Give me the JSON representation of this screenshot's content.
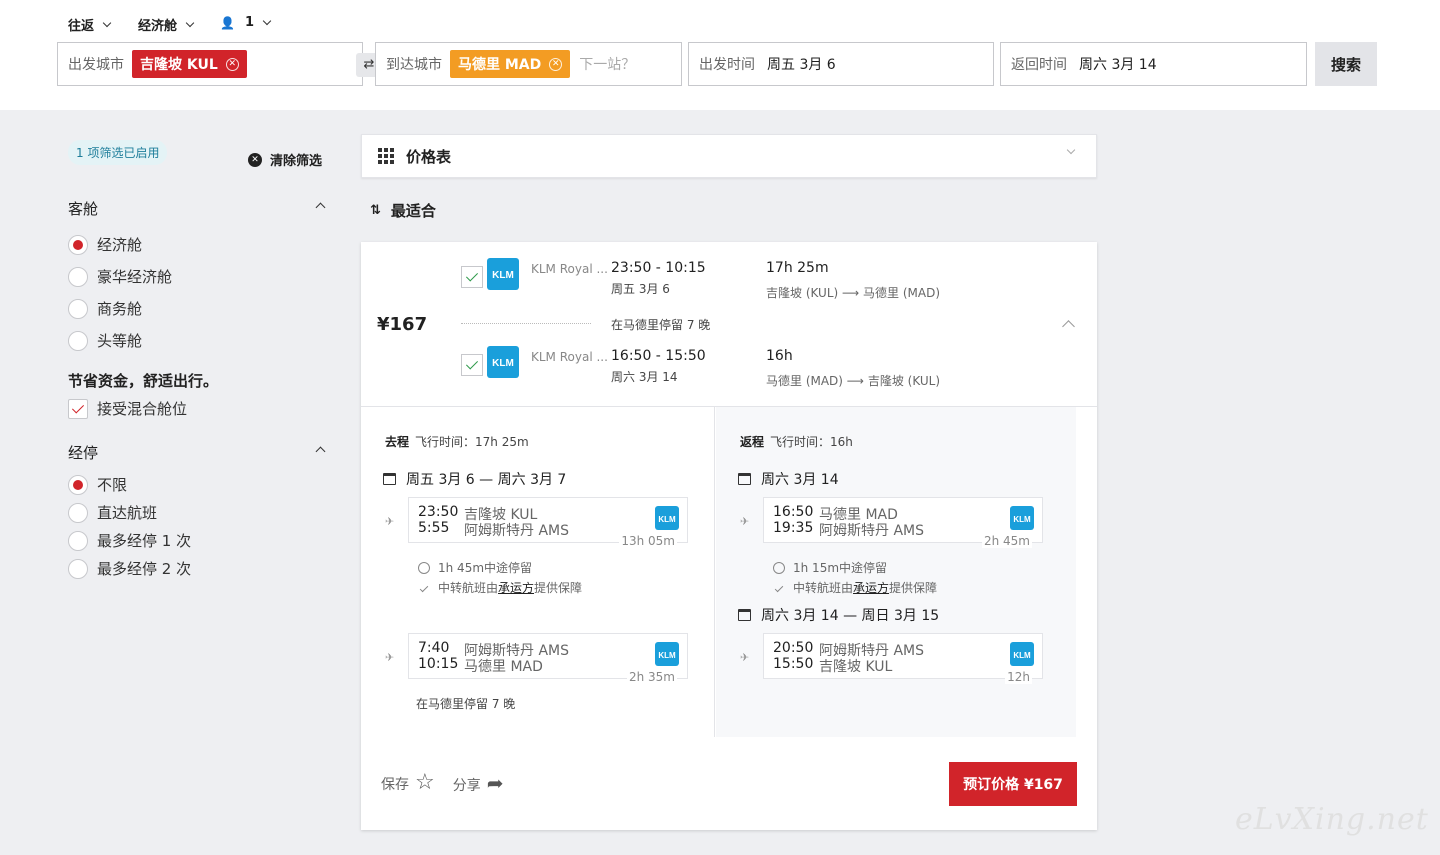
{
  "search": {
    "trip_type": "往返",
    "cabin_class": "经济舱",
    "passengers": "1",
    "from_label": "出发城市",
    "from_value": "吉隆坡 KUL",
    "to_label": "到达城市",
    "to_value": "马德里 MAD",
    "next_stop_placeholder": "下一站？",
    "depart_label": "出发时间",
    "depart_value": "周五 3月 6",
    "return_label": "返回时间",
    "return_value": "周六 3月 14",
    "search_label": "搜索"
  },
  "filters": {
    "active_badge": "1 项筛选已启用",
    "clear_label": "清除筛选",
    "cabin_title": "客舱",
    "cabin_options": [
      "经济舱",
      "豪华经济舱",
      "商务舱",
      "头等舱"
    ],
    "cabin_selected": 0,
    "mixed_title": "节省资金，舒适出行。",
    "mixed_label": "接受混合舱位",
    "stops_title": "经停",
    "stops_options": [
      "不限",
      "直达航班",
      "最多经停 1 次",
      "最多经停 2 次"
    ],
    "stops_selected": 0
  },
  "price_table_label": "价格表",
  "sort_label": "最适合",
  "result": {
    "price": "¥167",
    "outbound": {
      "airline": "KLM Royal ...",
      "times": "23:50 - 10:15",
      "date": "周五 3月 6",
      "duration": "17h 25m",
      "route_from": "吉隆坡 (KUL)",
      "route_to": "马德里 (MAD)"
    },
    "stay": "在马德里停留 7 晚",
    "inbound": {
      "airline": "KLM Royal ...",
      "times": "16:50 - 15:50",
      "date": "周六 3月 14",
      "duration": "16h",
      "route_from": "马德里 (MAD)",
      "route_to": "吉隆坡 (KUL)"
    },
    "details": {
      "out": {
        "title": "去程",
        "flight_time_label": "飞行时间：",
        "flight_time": "17h 25m",
        "day1": "周五 3月 6 — 周六 3月 7",
        "seg1": {
          "t1": "23:50",
          "p1": "吉隆坡 KUL",
          "t2": "5:55",
          "p2": "阿姆斯特丹 AMS",
          "dur": "13h 05m"
        },
        "layover": "1h 45m中途停留",
        "protect_pre": "中转航班由",
        "protect_link": "承运方",
        "protect_post": "提供保障",
        "seg2": {
          "t1": "7:40",
          "p1": "阿姆斯特丹 AMS",
          "t2": "10:15",
          "p2": "马德里 MAD",
          "dur": "2h 35m"
        },
        "stay": "在马德里停留 7 晚"
      },
      "back": {
        "title": "返程",
        "flight_time_label": "飞行时间：",
        "flight_time": "16h",
        "day1": "周六 3月 14",
        "seg1": {
          "t1": "16:50",
          "p1": "马德里 MAD",
          "t2": "19:35",
          "p2": "阿姆斯特丹 AMS",
          "dur": "2h 45m"
        },
        "layover": "1h 15m中途停留",
        "protect_pre": "中转航班由",
        "protect_link": "承运方",
        "protect_post": "提供保障",
        "day2": "周六 3月 14 — 周日 3月 15",
        "seg2": {
          "t1": "20:50",
          "p1": "阿姆斯特丹 AMS",
          "t2": "15:50",
          "p2": "吉隆坡 KUL",
          "dur": "12h"
        }
      }
    },
    "save_label": "保存",
    "share_label": "分享",
    "book_label": "预订价格 ¥167"
  },
  "watermark": "eLvXing.net",
  "colors": {
    "accent_red": "#d1242a",
    "chip_orange": "#f39c23",
    "klm_blue": "#1a9fdb"
  }
}
